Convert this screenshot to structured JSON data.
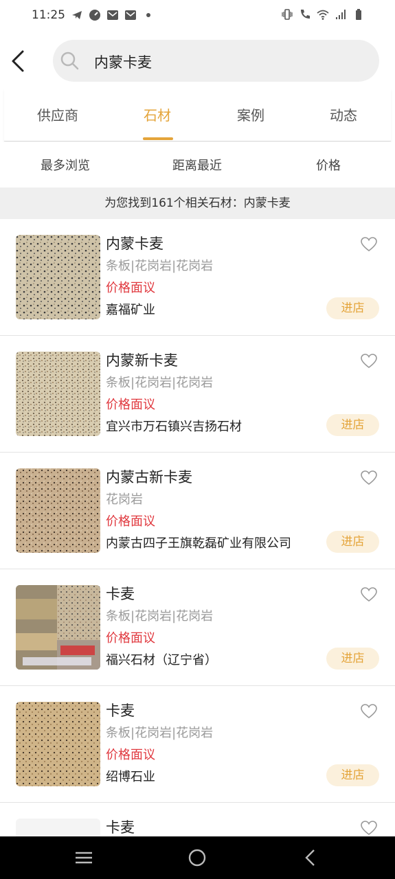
{
  "status": {
    "time": "11:25",
    "left_icons": [
      "telegram-icon",
      "speedometer-icon",
      "mail-icon",
      "mail-icon",
      "dot-icon"
    ],
    "right_icons": [
      "vibrate-icon",
      "wifi-call-icon",
      "wifi-icon",
      "signal-icon",
      "battery-icon"
    ]
  },
  "search": {
    "query": "内蒙卡麦"
  },
  "tabs": [
    {
      "label": "供应商",
      "active": false
    },
    {
      "label": "石材",
      "active": true
    },
    {
      "label": "案例",
      "active": false
    },
    {
      "label": "动态",
      "active": false
    }
  ],
  "sort_options": [
    {
      "label": "最多浏览"
    },
    {
      "label": "距离最近"
    },
    {
      "label": "价格"
    }
  ],
  "result_summary": "为您找到161个相关石材：内蒙卡麦",
  "colors": {
    "accent": "#e4a43a",
    "price": "#e0383e",
    "enter_bg": "#fbf0dc"
  },
  "items": [
    {
      "name": "内蒙卡麦",
      "type": "条板|花岗岩|花岗岩",
      "price": "价格面议",
      "company": "嘉福矿业",
      "button": "进店"
    },
    {
      "name": "内蒙新卡麦",
      "type": "条板|花岗岩|花岗岩",
      "price": "价格面议",
      "company": "宜兴市万石镇兴吉扬石材",
      "button": "进店"
    },
    {
      "name": "内蒙古新卡麦",
      "type": "花岗岩",
      "price": "价格面议",
      "company": "内蒙古四子王旗乾磊矿业有限公司",
      "button": "进店"
    },
    {
      "name": "卡麦",
      "type": "条板|花岗岩|花岗岩",
      "price": "价格面议",
      "company": "福兴石材（辽宁省）",
      "button": "进店"
    },
    {
      "name": "卡麦",
      "type": "条板|花岗岩|花岗岩",
      "price": "价格面议",
      "company": "绍博石业",
      "button": "进店"
    },
    {
      "name": "卡麦",
      "type": "",
      "price": "",
      "company": "",
      "button": ""
    }
  ],
  "navbar": [
    "menu-icon",
    "home-circle-icon",
    "back-triangle-icon"
  ]
}
